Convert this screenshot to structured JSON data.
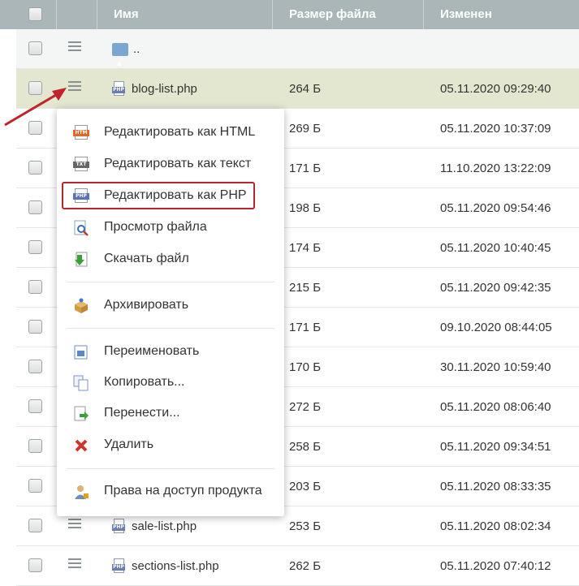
{
  "header": {
    "name": "Имя",
    "size": "Размер файла",
    "modified": "Изменен"
  },
  "parent_row": {
    "label": ".."
  },
  "rows": [
    {
      "name": "blog-list.php",
      "size": "264 Б",
      "date": "05.11.2020 09:29:40"
    },
    {
      "name": "",
      "size": "269 Б",
      "date": "05.11.2020 10:37:09"
    },
    {
      "name": "",
      "size": "171 Б",
      "date": "11.10.2020 13:22:09"
    },
    {
      "name": "",
      "size": "198 Б",
      "date": "05.11.2020 09:54:46"
    },
    {
      "name": "",
      "size": "174 Б",
      "date": "05.11.2020 10:40:45"
    },
    {
      "name": "",
      "size": "215 Б",
      "date": "05.11.2020 09:42:35"
    },
    {
      "name": "",
      "size": "171 Б",
      "date": "09.10.2020 08:44:05"
    },
    {
      "name": "",
      "size": "170 Б",
      "date": "30.11.2020 10:59:40"
    },
    {
      "name": "",
      "size": "272 Б",
      "date": "05.11.2020 08:06:40"
    },
    {
      "name": "",
      "size": "258 Б",
      "date": "05.11.2020 09:34:51"
    },
    {
      "name": "",
      "size": "203 Б",
      "date": "05.11.2020 08:33:35"
    },
    {
      "name": "sale-list.php",
      "size": "253 Б",
      "date": "05.11.2020 08:02:34"
    },
    {
      "name": "sections-list.php",
      "size": "262 Б",
      "date": "05.11.2020 07:40:12"
    }
  ],
  "context_menu": {
    "edit_html": "Редактировать как HTML",
    "edit_text": "Редактировать как текст",
    "edit_php": "Редактировать как PHP",
    "view": "Просмотр файла",
    "download": "Скачать файл",
    "archive": "Архивировать",
    "rename": "Переименовать",
    "copy": "Копировать...",
    "move": "Перенести...",
    "delete": "Удалить",
    "access": "Права на доступ продукта"
  },
  "icons": {
    "html_tag": "HTM",
    "text_tag": "TXT",
    "php_tag": "PHP"
  },
  "colors": {
    "header": "#aab6b8",
    "highlight_row": "#e3e7cf",
    "highlight_border": "#b8262c"
  }
}
